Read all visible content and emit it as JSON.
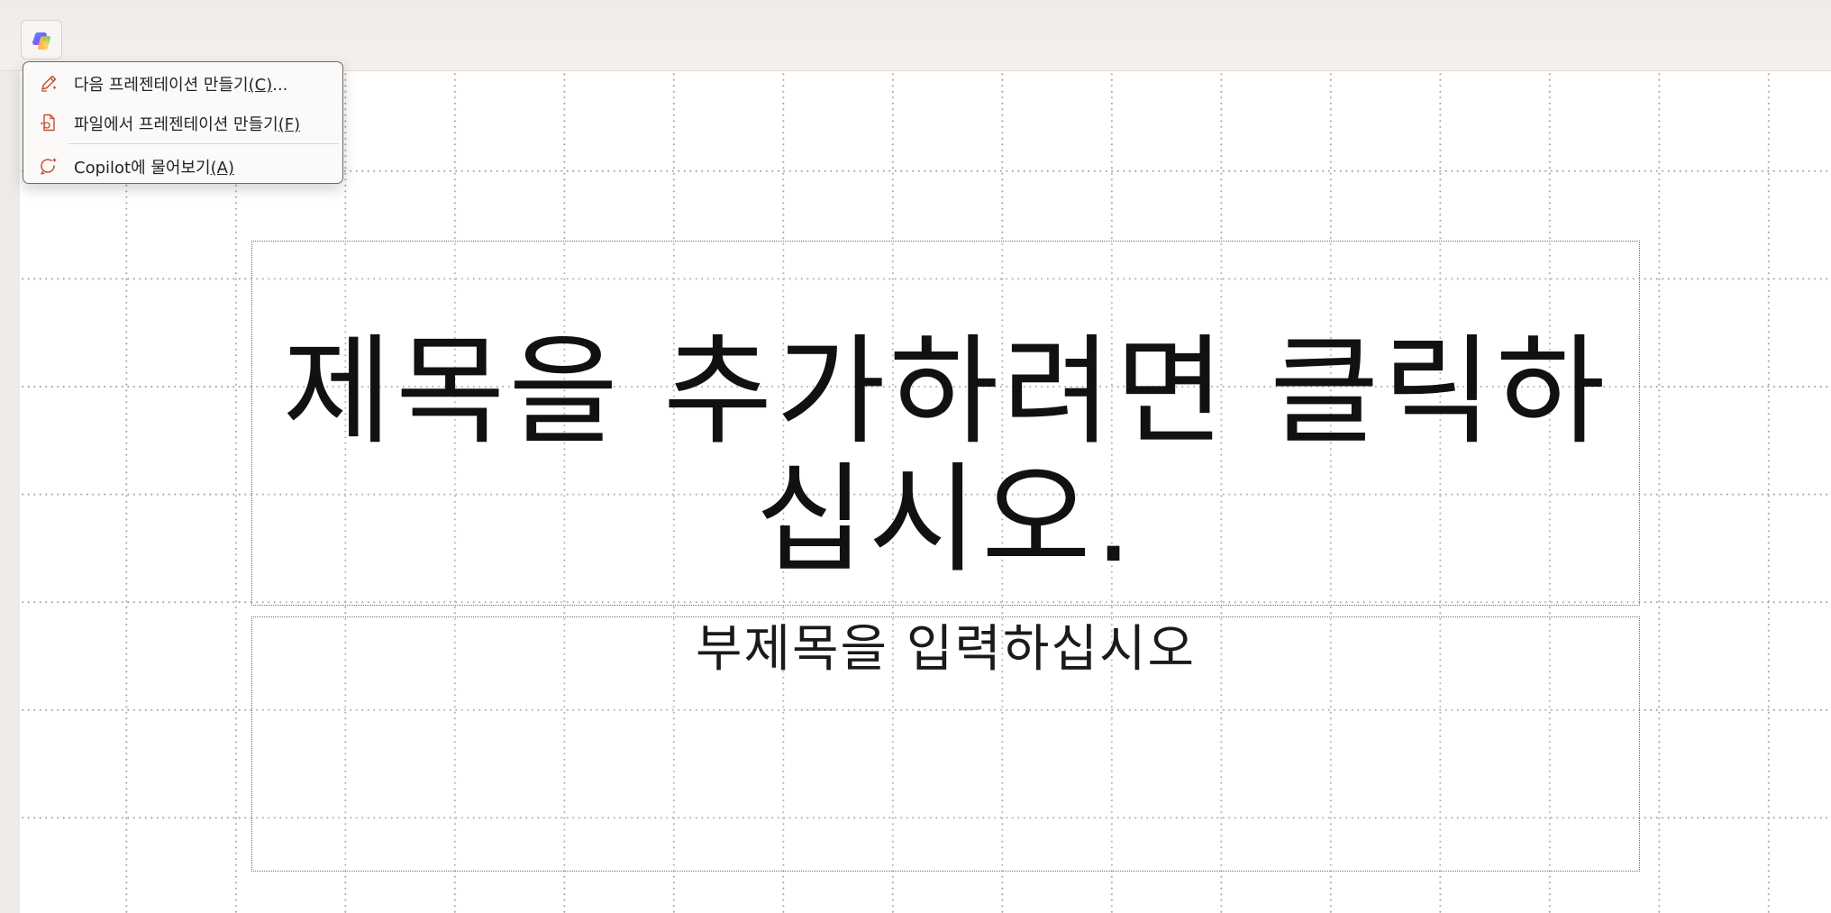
{
  "toolbar": {
    "copilot_button_icon": "copilot-icon"
  },
  "copilot_menu": {
    "items": [
      {
        "icon": "pencil-edit-icon",
        "label": "다음 프레젠테이션 만들기",
        "mnemonic": "(C)",
        "suffix": "..."
      },
      {
        "icon": "file-create-icon",
        "label": "파일에서 프레젠테이션 만들기",
        "mnemonic": "(F)",
        "suffix": ""
      },
      {
        "icon": "copilot-chat-icon",
        "label": "Copilot에 물어보기",
        "mnemonic": "(A)",
        "suffix": ""
      }
    ]
  },
  "slide": {
    "title_line1": "제목을 추가하려면 클릭하",
    "title_line2": "십시오.",
    "subtitle": "부제목을 입력하십시오"
  },
  "colors": {
    "accent_icon": "#c4502e",
    "background": "#f1edeb"
  }
}
